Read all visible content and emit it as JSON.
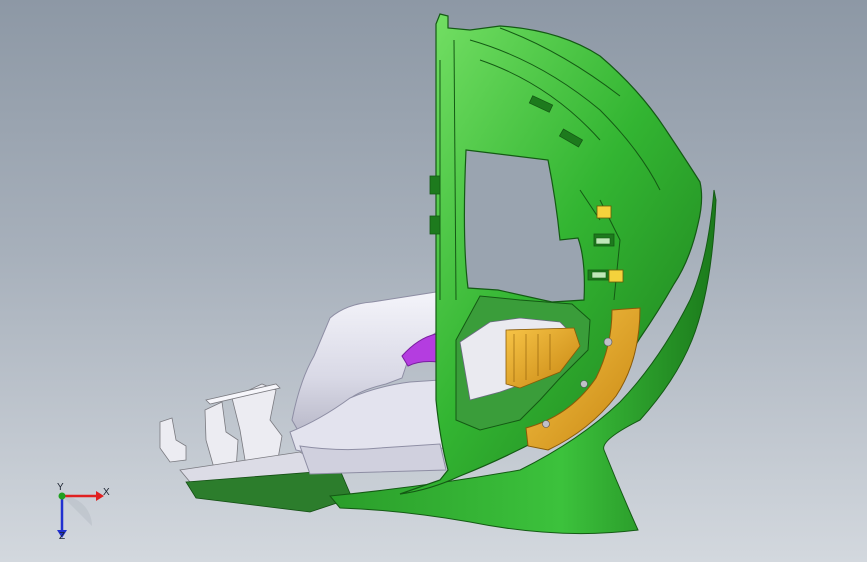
{
  "viewport": {
    "background_top": "#8d98a5",
    "background_bottom": "#d3d8de"
  },
  "model": {
    "body_color": "#2fb12f",
    "body_dark": "#1c7d1c",
    "body_light": "#6fdb5e",
    "insert_color": "#e9a620",
    "shroud_color": "#e6e6ef",
    "accent_color": "#b03ad6",
    "fastener_color": "#f4d23c"
  },
  "triad": {
    "x_label": "X",
    "y_label": "Y",
    "z_label": "Z",
    "x_color": "#e02020",
    "y_color": "#20a020",
    "z_color": "#2030d0"
  }
}
